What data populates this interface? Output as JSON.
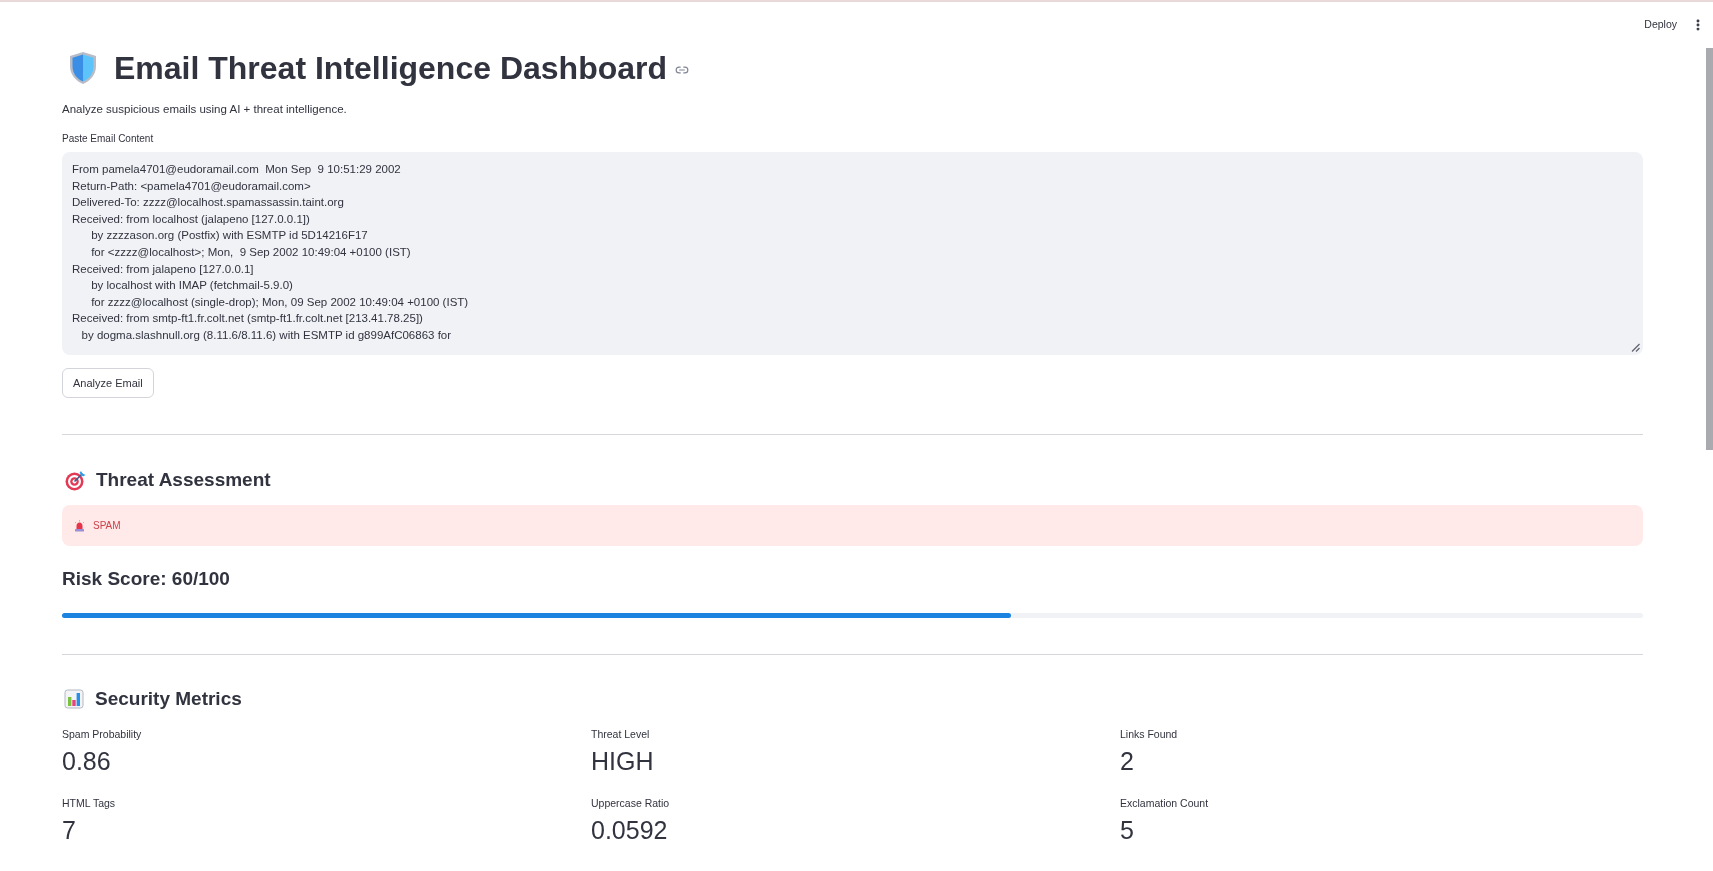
{
  "header": {
    "deploy_button": "Deploy"
  },
  "title": "Email Threat Intelligence Dashboard",
  "subtitle": "Analyze suspicious emails using AI + threat intelligence.",
  "email_input": {
    "label": "Paste Email Content",
    "lines": [
      "From pamela4701@eudoramail.com  Mon Sep  9 10:51:29 2002",
      "Return-Path: <pamela4701@eudoramail.com>",
      "Delivered-To: zzzz@localhost.spamassassin.taint.org",
      "Received: from localhost (jalapeno [127.0.0.1])",
      "      by zzzzason.org (Postfix) with ESMTP id 5D14216F17",
      "      for <zzzz@localhost>; Mon,  9 Sep 2002 10:49:04 +0100 (IST)",
      "Received: from jalapeno [127.0.0.1]",
      "      by localhost with IMAP (fetchmail-5.9.0)",
      "      for zzzz@localhost (single-drop); Mon, 09 Sep 2002 10:49:04 +0100 (IST)",
      "Received: from smtp-ft1.fr.colt.net (smtp-ft1.fr.colt.net [213.41.78.25])",
      "   by dogma.slashnull.org (8.11.6/8.11.6) with ESMTP id g899AfC06863 for"
    ]
  },
  "analyze_button": "Analyze Email",
  "threat_assessment": {
    "heading": "Threat Assessment",
    "alert": {
      "kind": "error",
      "text": "SPAM"
    },
    "risk_score": {
      "label": "Risk Score: 60/100",
      "level": 0.6
    }
  },
  "security_metrics": {
    "heading": "Security Metrics",
    "metrics": [
      {
        "label": "Spam Probability",
        "value": "0.86"
      },
      {
        "label": "Threat Level",
        "value": "HIGH"
      },
      {
        "label": "Links Found",
        "value": "2"
      },
      {
        "label": "HTML Tags",
        "value": "7"
      },
      {
        "label": "Uppercase Ratio",
        "value": "0.0592"
      },
      {
        "label": "Exclamation Count",
        "value": "5"
      }
    ]
  }
}
